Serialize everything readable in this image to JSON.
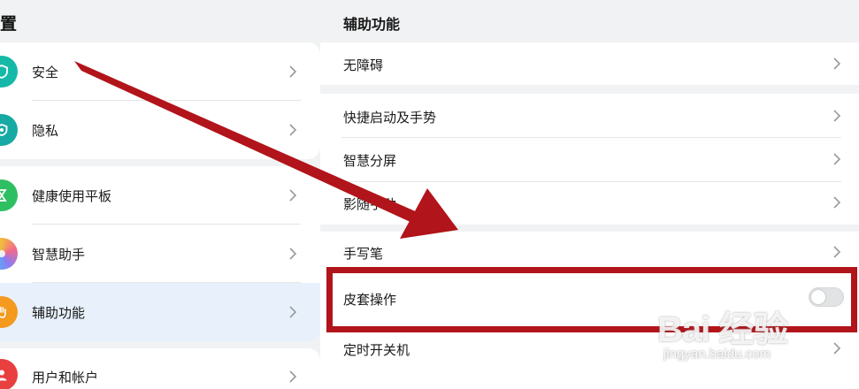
{
  "left_header": {
    "title": "置"
  },
  "sidebar": {
    "items": [
      {
        "label": "安全",
        "icon": "shield-icon",
        "color": "#16b9a8"
      },
      {
        "label": "隐私",
        "icon": "privacy-icon",
        "color": "#17a9a3"
      },
      {
        "label": "健康使用平板",
        "icon": "hourglass-icon",
        "color": "#2fbf63"
      },
      {
        "label": "智慧助手",
        "icon": "assistant-icon",
        "color": "#f0a13b"
      },
      {
        "label": "辅助功能",
        "icon": "hand-icon",
        "color": "#f39a1f",
        "selected": true
      },
      {
        "label": "用户和帐户",
        "icon": "user-icon",
        "color": "#e8403f"
      }
    ]
  },
  "detail": {
    "title": "辅助功能",
    "rows": [
      {
        "label": "无障碍",
        "control": "chevron"
      },
      {
        "label": "快捷启动及手势",
        "control": "chevron"
      },
      {
        "label": "智慧分屏",
        "control": "chevron"
      },
      {
        "label": "影随手动",
        "control": "chevron"
      },
      {
        "label": "手写笔",
        "control": "chevron"
      },
      {
        "label": "皮套操作",
        "control": "toggle",
        "toggle_on": false
      },
      {
        "label": "定时开关机",
        "control": "chevron"
      }
    ]
  },
  "annotation": {
    "highlight_color": "#b1141a",
    "arrow_color": "#b1141a"
  },
  "watermark": {
    "logo_text": "Bai 经验",
    "url": "jingyan.baidu.com"
  }
}
